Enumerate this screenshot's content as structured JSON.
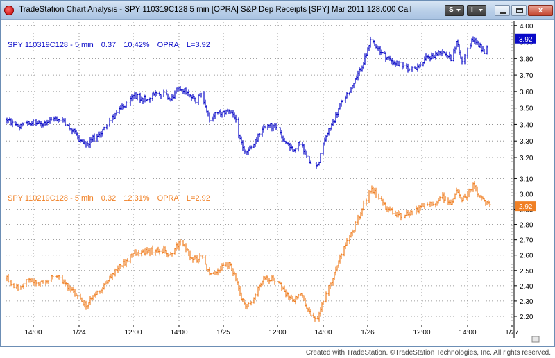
{
  "window": {
    "title": "TradeStation Chart Analysis - SPY 110319C128 5 min [OPRA] S&P Dep Receipts [SPY] Mar 2011 128.000 Call",
    "toolbar": {
      "s_label": "S",
      "i_label": "I"
    },
    "close_glyph": "x"
  },
  "credit": "Created with TradeStation. ©TradeStation Technologies, Inc. All rights reserved.",
  "colors": {
    "upper": "#0a0ac8",
    "lower": "#f08025",
    "grid": "#808080"
  },
  "chart_data": [
    {
      "type": "bar",
      "legend": {
        "name": "SPY 110319C128 - 5 min",
        "last": "0.37",
        "pct": "10.42%",
        "exchange": "OPRA",
        "label": "L=3.92"
      },
      "last_value_badge": "3.92",
      "ylim": [
        3.12,
        4.02
      ],
      "yticks": [
        "4.00",
        "3.90",
        "3.80",
        "3.70",
        "3.60",
        "3.50",
        "3.40",
        "3.30",
        "3.20"
      ],
      "grid": true,
      "keypoints": [
        [
          0,
          3.43
        ],
        [
          8,
          3.38
        ],
        [
          15,
          3.42
        ],
        [
          24,
          3.4
        ],
        [
          35,
          3.44
        ],
        [
          44,
          3.4
        ],
        [
          52,
          3.31
        ],
        [
          58,
          3.27
        ],
        [
          62,
          3.32
        ],
        [
          68,
          3.35
        ],
        [
          74,
          3.42
        ],
        [
          80,
          3.48
        ],
        [
          86,
          3.52
        ],
        [
          92,
          3.58
        ],
        [
          96,
          3.55
        ],
        [
          100,
          3.56
        ],
        [
          108,
          3.59
        ],
        [
          114,
          3.58
        ],
        [
          118,
          3.55
        ],
        [
          122,
          3.6
        ],
        [
          126,
          3.62
        ],
        [
          132,
          3.57
        ],
        [
          136,
          3.55
        ],
        [
          140,
          3.6
        ],
        [
          146,
          3.42
        ],
        [
          150,
          3.46
        ],
        [
          156,
          3.47
        ],
        [
          160,
          3.49
        ],
        [
          164,
          3.45
        ],
        [
          168,
          3.31
        ],
        [
          172,
          3.22
        ],
        [
          178,
          3.28
        ],
        [
          184,
          3.38
        ],
        [
          190,
          3.39
        ],
        [
          196,
          3.37
        ],
        [
          200,
          3.3
        ],
        [
          206,
          3.25
        ],
        [
          212,
          3.3
        ],
        [
          216,
          3.2
        ],
        [
          220,
          3.16
        ],
        [
          224,
          3.15
        ],
        [
          230,
          3.33
        ],
        [
          236,
          3.43
        ],
        [
          242,
          3.55
        ],
        [
          248,
          3.62
        ],
        [
          252,
          3.68
        ],
        [
          258,
          3.8
        ],
        [
          262,
          3.9
        ],
        [
          266,
          3.88
        ],
        [
          272,
          3.82
        ],
        [
          278,
          3.78
        ],
        [
          284,
          3.76
        ],
        [
          290,
          3.73
        ],
        [
          296,
          3.75
        ],
        [
          302,
          3.8
        ],
        [
          308,
          3.82
        ],
        [
          314,
          3.85
        ],
        [
          320,
          3.8
        ],
        [
          324,
          3.9
        ],
        [
          328,
          3.78
        ],
        [
          332,
          3.85
        ],
        [
          336,
          3.92
        ],
        [
          340,
          3.88
        ],
        [
          344,
          3.84
        ],
        [
          348,
          3.92
        ]
      ]
    },
    {
      "type": "bar",
      "legend": {
        "name": "SPY 110219C128 - 5 min",
        "last": "0.32",
        "pct": "12.31%",
        "exchange": "OPRA",
        "label": "L=2.92"
      },
      "last_value_badge": "2.92",
      "ylim": [
        2.15,
        3.12
      ],
      "yticks": [
        "3.10",
        "3.00",
        "2.90",
        "2.80",
        "2.70",
        "2.60",
        "2.50",
        "2.40",
        "2.30",
        "2.20"
      ],
      "grid": true,
      "keypoints": [
        [
          0,
          2.45
        ],
        [
          8,
          2.38
        ],
        [
          15,
          2.43
        ],
        [
          24,
          2.42
        ],
        [
          35,
          2.46
        ],
        [
          44,
          2.4
        ],
        [
          52,
          2.31
        ],
        [
          58,
          2.27
        ],
        [
          62,
          2.33
        ],
        [
          68,
          2.38
        ],
        [
          74,
          2.45
        ],
        [
          80,
          2.52
        ],
        [
          86,
          2.56
        ],
        [
          92,
          2.62
        ],
        [
          96,
          2.6
        ],
        [
          100,
          2.62
        ],
        [
          108,
          2.64
        ],
        [
          114,
          2.63
        ],
        [
          118,
          2.6
        ],
        [
          122,
          2.66
        ],
        [
          126,
          2.68
        ],
        [
          132,
          2.6
        ],
        [
          136,
          2.57
        ],
        [
          140,
          2.6
        ],
        [
          146,
          2.47
        ],
        [
          150,
          2.5
        ],
        [
          156,
          2.52
        ],
        [
          160,
          2.54
        ],
        [
          164,
          2.48
        ],
        [
          168,
          2.35
        ],
        [
          172,
          2.25
        ],
        [
          178,
          2.32
        ],
        [
          184,
          2.44
        ],
        [
          190,
          2.45
        ],
        [
          196,
          2.43
        ],
        [
          200,
          2.35
        ],
        [
          206,
          2.3
        ],
        [
          212,
          2.36
        ],
        [
          216,
          2.25
        ],
        [
          220,
          2.2
        ],
        [
          224,
          2.18
        ],
        [
          230,
          2.35
        ],
        [
          236,
          2.48
        ],
        [
          242,
          2.62
        ],
        [
          248,
          2.74
        ],
        [
          252,
          2.82
        ],
        [
          258,
          2.95
        ],
        [
          262,
          3.03
        ],
        [
          266,
          3.0
        ],
        [
          272,
          2.92
        ],
        [
          278,
          2.88
        ],
        [
          284,
          2.86
        ],
        [
          290,
          2.88
        ],
        [
          296,
          2.9
        ],
        [
          302,
          2.93
        ],
        [
          308,
          2.95
        ],
        [
          314,
          2.98
        ],
        [
          320,
          2.93
        ],
        [
          324,
          3.02
        ],
        [
          328,
          2.96
        ],
        [
          332,
          3.0
        ],
        [
          336,
          3.05
        ],
        [
          340,
          2.98
        ],
        [
          344,
          2.95
        ],
        [
          348,
          2.92
        ]
      ]
    }
  ],
  "x_axis": {
    "labels": [
      {
        "text": "14:00",
        "bar": 19
      },
      {
        "text": "1/24",
        "bar": 52
      },
      {
        "text": "12:00",
        "bar": 91
      },
      {
        "text": "14:00",
        "bar": 124
      },
      {
        "text": "1/25",
        "bar": 156
      },
      {
        "text": "12:00",
        "bar": 195
      },
      {
        "text": "14:00",
        "bar": 228
      },
      {
        "text": "1/26",
        "bar": 260
      },
      {
        "text": "12:00",
        "bar": 299
      },
      {
        "text": "14:00",
        "bar": 332
      },
      {
        "text": "1/27",
        "bar": 364
      }
    ],
    "day_breaks": [
      52,
      156,
      260,
      364
    ]
  }
}
